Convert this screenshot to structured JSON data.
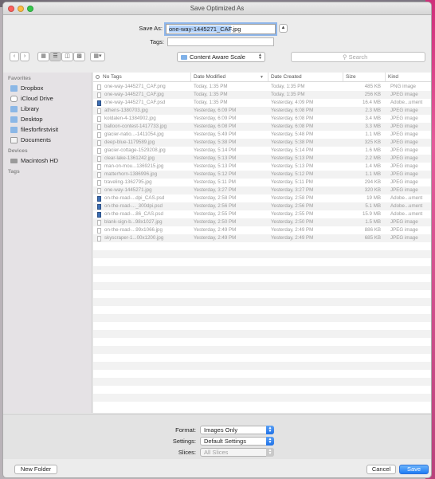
{
  "window": {
    "title": "Save Optimized As"
  },
  "form": {
    "save_as_label": "Save As:",
    "save_as_selected": "one-way-1445271_CAF",
    "save_as_ext": ".jpg",
    "tags_label": "Tags:",
    "tags_value": ""
  },
  "toolbar": {
    "location": "Content Aware Scale",
    "search_placeholder": "Search"
  },
  "sidebar": {
    "favorites_header": "Favorites",
    "favorites": [
      {
        "label": "Dropbox",
        "icon": "folder-icon"
      },
      {
        "label": "iCloud Drive",
        "icon": "cloud-icon"
      },
      {
        "label": "Library",
        "icon": "folder-icon"
      },
      {
        "label": "Desktop",
        "icon": "folder-icon"
      },
      {
        "label": "filesforfirstvisit",
        "icon": "folder-icon"
      },
      {
        "label": "Documents",
        "icon": "document-icon"
      }
    ],
    "devices_header": "Devices",
    "devices": [
      {
        "label": "Macintosh HD",
        "icon": "disk-icon"
      }
    ],
    "tags_header": "Tags"
  },
  "columns": {
    "name": "No Tags",
    "modified": "Date Modified",
    "created": "Date Created",
    "size": "Size",
    "kind": "Kind"
  },
  "files": [
    {
      "name": "one-way-1445271_CAF.png",
      "modified": "Today, 1:35 PM",
      "created": "Today, 1:35 PM",
      "size": "485 KB",
      "kind": "PNG image",
      "psd": false
    },
    {
      "name": "one-way-1445271_CAF.jpg",
      "modified": "Today, 1:35 PM",
      "created": "Today, 1:35 PM",
      "size": "256 KB",
      "kind": "JPEG image",
      "psd": false
    },
    {
      "name": "one-way-1445271_CAF.psd",
      "modified": "Today, 1:35 PM",
      "created": "Yesterday, 4:09 PM",
      "size": "16.4 MB",
      "kind": "Adobe...ument",
      "psd": true
    },
    {
      "name": "athens-1380703.jpg",
      "modified": "Yesterday, 6:09 PM",
      "created": "Yesterday, 6:08 PM",
      "size": "2.3 MB",
      "kind": "JPEG image",
      "psd": false
    },
    {
      "name": "koldalen-4-1384902.jpg",
      "modified": "Yesterday, 6:09 PM",
      "created": "Yesterday, 6:08 PM",
      "size": "3.4 MB",
      "kind": "JPEG image",
      "psd": false
    },
    {
      "name": "balloon-contest-1417733.jpg",
      "modified": "Yesterday, 6:08 PM",
      "created": "Yesterday, 6:08 PM",
      "size": "3.3 MB",
      "kind": "JPEG image",
      "psd": false
    },
    {
      "name": "glacier-natio...-1411054.jpg",
      "modified": "Yesterday, 5:49 PM",
      "created": "Yesterday, 5:48 PM",
      "size": "1.1 MB",
      "kind": "JPEG image",
      "psd": false
    },
    {
      "name": "deep-blue-1179589.jpg",
      "modified": "Yesterday, 5:38 PM",
      "created": "Yesterday, 5:38 PM",
      "size": "325 KB",
      "kind": "JPEG image",
      "psd": false
    },
    {
      "name": "glacier-cottage-1529208.jpg",
      "modified": "Yesterday, 5:14 PM",
      "created": "Yesterday, 5:14 PM",
      "size": "1.6 MB",
      "kind": "JPEG image",
      "psd": false
    },
    {
      "name": "clear-lake-1361242.jpg",
      "modified": "Yesterday, 5:13 PM",
      "created": "Yesterday, 5:13 PM",
      "size": "2.2 MB",
      "kind": "JPEG image",
      "psd": false
    },
    {
      "name": "man-on-mou...1369215.jpg",
      "modified": "Yesterday, 5:13 PM",
      "created": "Yesterday, 5:13 PM",
      "size": "1.4 MB",
      "kind": "JPEG image",
      "psd": false
    },
    {
      "name": "matterhorn-1386996.jpg",
      "modified": "Yesterday, 5:12 PM",
      "created": "Yesterday, 5:12 PM",
      "size": "1.1 MB",
      "kind": "JPEG image",
      "psd": false
    },
    {
      "name": "traveling-1362795.jpg",
      "modified": "Yesterday, 5:11 PM",
      "created": "Yesterday, 5:11 PM",
      "size": "294 KB",
      "kind": "JPEG image",
      "psd": false
    },
    {
      "name": "one-way-1445271.jpg",
      "modified": "Yesterday, 3:27 PM",
      "created": "Yesterday, 3:27 PM",
      "size": "320 KB",
      "kind": "JPEG image",
      "psd": false
    },
    {
      "name": "on-the-road-...dpi_CAS.psd",
      "modified": "Yesterday, 2:58 PM",
      "created": "Yesterday, 2:58 PM",
      "size": "19 MB",
      "kind": "Adobe...ument",
      "psd": true
    },
    {
      "name": "on-the-road-..._300dpi.psd",
      "modified": "Yesterday, 2:56 PM",
      "created": "Yesterday, 2:56 PM",
      "size": "5.1 MB",
      "kind": "Adobe...ument",
      "psd": true
    },
    {
      "name": "on-the-road-...86_CAS.psd",
      "modified": "Yesterday, 2:55 PM",
      "created": "Yesterday, 2:55 PM",
      "size": "15.9 MB",
      "kind": "Adobe...ument",
      "psd": true
    },
    {
      "name": "blank-sign-b...98x1027.jpg",
      "modified": "Yesterday, 2:50 PM",
      "created": "Yesterday, 2:50 PM",
      "size": "1.5 MB",
      "kind": "JPEG image",
      "psd": false
    },
    {
      "name": "on-the-road-...99x1066.jpg",
      "modified": "Yesterday, 2:49 PM",
      "created": "Yesterday, 2:49 PM",
      "size": "886 KB",
      "kind": "JPEG image",
      "psd": false
    },
    {
      "name": "skyscraper-1...00x1200.jpg",
      "modified": "Yesterday, 2:49 PM",
      "created": "Yesterday, 2:49 PM",
      "size": "685 KB",
      "kind": "JPEG image",
      "psd": false
    }
  ],
  "options": {
    "format_label": "Format:",
    "format_value": "Images Only",
    "settings_label": "Settings:",
    "settings_value": "Default Settings",
    "slices_label": "Slices:",
    "slices_value": "All Slices"
  },
  "buttons": {
    "new_folder": "New Folder",
    "cancel": "Cancel",
    "save": "Save"
  },
  "colors": {
    "accent": "#1e7cf5",
    "selection": "#b4d3fb",
    "sidebar_bg": "#e5e2e5"
  }
}
